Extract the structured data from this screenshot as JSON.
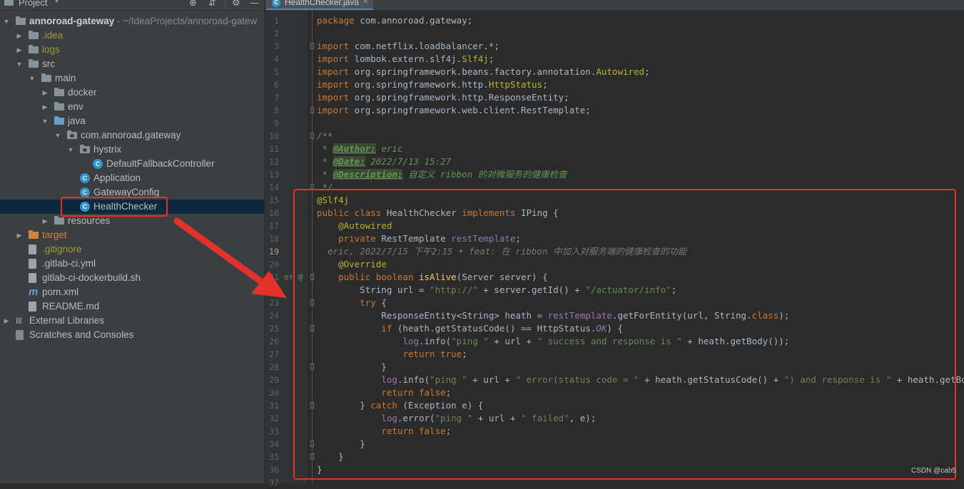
{
  "project_panel": {
    "title": "Project",
    "tree": [
      {
        "label": "annoroad-gateway",
        "hint": " ~/IdeaProjects/annoroad-gatew",
        "indent": 0,
        "arrow": "open",
        "icon": "folder",
        "style": "bold"
      },
      {
        "label": ".idea",
        "indent": 1,
        "arrow": "closed",
        "icon": "folder",
        "style": "olive"
      },
      {
        "label": "logs",
        "indent": 1,
        "arrow": "closed",
        "icon": "folder",
        "style": "olive"
      },
      {
        "label": "src",
        "indent": 1,
        "arrow": "open",
        "icon": "folder",
        "style": "normal"
      },
      {
        "label": "main",
        "indent": 2,
        "arrow": "open",
        "icon": "folder",
        "style": "normal"
      },
      {
        "label": "docker",
        "indent": 3,
        "arrow": "closed",
        "icon": "folder",
        "style": "normal"
      },
      {
        "label": "env",
        "indent": 3,
        "arrow": "closed",
        "icon": "folder",
        "style": "normal"
      },
      {
        "label": "java",
        "indent": 3,
        "arrow": "open",
        "icon": "folder-src",
        "style": "normal"
      },
      {
        "label": "com.annoroad.gateway",
        "indent": 4,
        "arrow": "open",
        "icon": "package",
        "style": "normal"
      },
      {
        "label": "hystrix",
        "indent": 5,
        "arrow": "open",
        "icon": "package",
        "style": "normal"
      },
      {
        "label": "DefaultFallbackController",
        "indent": 6,
        "arrow": "none",
        "icon": "class",
        "style": "normal"
      },
      {
        "label": "Application",
        "indent": 5,
        "arrow": "none",
        "icon": "class",
        "style": "normal"
      },
      {
        "label": "GatewayConfig",
        "indent": 5,
        "arrow": "none",
        "icon": "class",
        "style": "normal"
      },
      {
        "label": "HealthChecker",
        "indent": 5,
        "arrow": "none",
        "icon": "class",
        "style": "normal",
        "selected": true
      },
      {
        "label": "resources",
        "indent": 3,
        "arrow": "closed",
        "icon": "folder-res",
        "style": "normal"
      },
      {
        "label": "target",
        "indent": 1,
        "arrow": "closed",
        "icon": "folder-orange",
        "style": "orange"
      },
      {
        "label": ".gitignore",
        "indent": 1,
        "arrow": "none",
        "icon": "file",
        "style": "olive"
      },
      {
        "label": ".gitlab-ci.yml",
        "indent": 1,
        "arrow": "none",
        "icon": "file-yml",
        "style": "normal"
      },
      {
        "label": "gitlab-ci-dockerbuild.sh",
        "indent": 1,
        "arrow": "none",
        "icon": "file",
        "style": "normal"
      },
      {
        "label": "pom.xml",
        "indent": 1,
        "arrow": "none",
        "icon": "maven",
        "style": "normal"
      },
      {
        "label": "README.md",
        "indent": 1,
        "arrow": "none",
        "icon": "file-md",
        "style": "normal"
      },
      {
        "label": "External Libraries",
        "indent": 0,
        "arrow": "closed",
        "icon": "libraries",
        "style": "normal"
      },
      {
        "label": "Scratches and Consoles",
        "indent": 0,
        "arrow": "none",
        "icon": "scratches",
        "style": "normal"
      }
    ]
  },
  "editor": {
    "tab_label": "HealthChecker.java",
    "lines": [
      {
        "n": "1",
        "html": "<span class='kw'>package</span> com.annoroad.gateway;"
      },
      {
        "n": "2",
        "html": ""
      },
      {
        "n": "3",
        "html": "<span class='kw'>import</span> com.netflix.loadbalancer.*;"
      },
      {
        "n": "4",
        "html": "<span class='kw'>import</span> lombok.extern.slf4j.<span class='ann'>Slf4j</span>;"
      },
      {
        "n": "5",
        "html": "<span class='kw'>import</span> org.springframework.beans.factory.annotation.<span class='ann'>Autowired</span>;"
      },
      {
        "n": "6",
        "html": "<span class='kw'>import</span> org.springframework.http.<span class='ann'>HttpStatus</span>;"
      },
      {
        "n": "7",
        "html": "<span class='kw'>import</span> org.springframework.http.ResponseEntity;"
      },
      {
        "n": "8",
        "html": "<span class='kw'>import</span> org.springframework.web.client.RestTemplate;"
      },
      {
        "n": "9",
        "html": ""
      },
      {
        "n": "10",
        "html": "<span class='doc'>/**</span>"
      },
      {
        "n": "11",
        "html": "<span class='doc'> * </span><span class='doctag'>@Author:</span><span class='doc'> eric</span>"
      },
      {
        "n": "12",
        "html": "<span class='doc'> * </span><span class='doctag'>@Date:</span><span class='doc'> 2022/7/13 15:27</span>"
      },
      {
        "n": "13",
        "html": "<span class='doc'> * </span><span class='doctag'>@Description:</span><span class='doc'> 自定义 ribbon 的对微服务的健康检查</span>"
      },
      {
        "n": "14",
        "html": "<span class='doc'> */</span>"
      },
      {
        "n": "15",
        "html": "<span class='ann'>@Slf4j</span>"
      },
      {
        "n": "16",
        "html": "<span class='kw'>public class</span> HealthChecker <span class='kw'>implements</span> IPing {"
      },
      {
        "n": "17",
        "html": "    <span class='ann'>@Autowired</span>"
      },
      {
        "n": "18",
        "html": "    <span class='kw'>private</span> RestTemplate <span class='field'>restTemplate</span>;"
      },
      {
        "n": "19",
        "html": "  <span class='blame'>eric, 2022/7/15 下午2:15 • feat: 在 ribbon 中加入对服务端的健康检查的功能</span>"
      },
      {
        "n": "20",
        "html": "    <span class='ann'>@Override</span>"
      },
      {
        "n": "21",
        "html": "    <span class='kw'>public boolean</span> <span class='fn'>isAlive</span>(Server server) {"
      },
      {
        "n": "22",
        "html": "        String url = <span class='str'>\"http://\"</span> + server.getId() + <span class='str'>\"/actuator/info\"</span>;"
      },
      {
        "n": "23",
        "html": "        <span class='kw'>try</span> {"
      },
      {
        "n": "24",
        "html": "            ResponseEntity&lt;String&gt; heath = <span class='field'>restTemplate</span>.getForEntity(url, String.<span class='kw'>class</span>);"
      },
      {
        "n": "25",
        "html": "            <span class='kw'>if</span> (heath.getStatusCode() == HttpStatus.<span class='stat'>OK</span>) {"
      },
      {
        "n": "26",
        "html": "                <span class='field'>log</span>.info(<span class='str'>\"ping \"</span> + url + <span class='str'>\" success and response is \"</span> + heath.getBody());"
      },
      {
        "n": "27",
        "html": "                <span class='kw'>return true</span>;"
      },
      {
        "n": "28",
        "html": "            }"
      },
      {
        "n": "29",
        "html": "            <span class='field'>log</span>.info(<span class='str'>\"ping \"</span> + url + <span class='str'>\" error(status code = \"</span> + heath.getStatusCode() + <span class='str'>\") and response is \"</span> + heath.getBody());"
      },
      {
        "n": "30",
        "html": "            <span class='kw'>return false</span>;"
      },
      {
        "n": "31",
        "html": "        } <span class='kw'>catch</span> (Exception e) {"
      },
      {
        "n": "32",
        "html": "            <span class='field'>log</span>.error(<span class='str'>\"ping \"</span> + url + <span class='str'>\" failed\"</span>, e);"
      },
      {
        "n": "33",
        "html": "            <span class='kw'>return false</span>;"
      },
      {
        "n": "34",
        "html": "        }"
      },
      {
        "n": "35",
        "html": "    }"
      },
      {
        "n": "36",
        "html": "}"
      },
      {
        "n": "37",
        "html": ""
      }
    ]
  },
  "watermark": "CSDN @cab5",
  "colors": {
    "highlight": "#e4312a",
    "selection": "#0d293e",
    "accent": "#4a88c7"
  }
}
